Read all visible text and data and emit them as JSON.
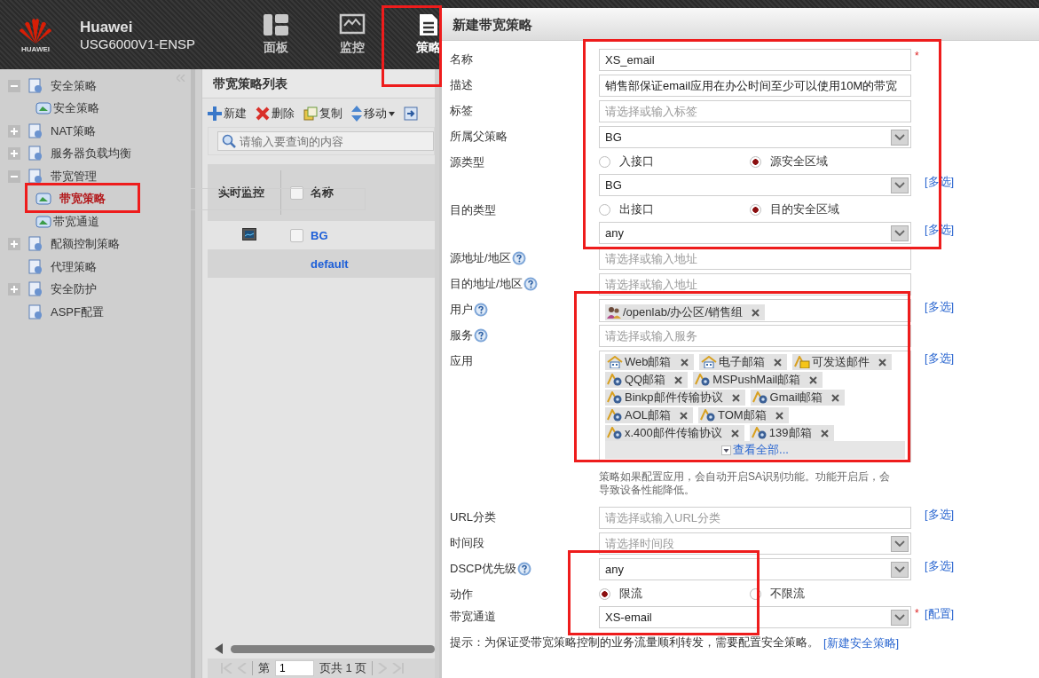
{
  "header": {
    "logo_text": "HUAWEI",
    "brand": "Huawei",
    "model": "USG6000V1-ENSP",
    "nav": [
      {
        "label": "面板",
        "selected": false,
        "highlighted": false
      },
      {
        "label": "监控",
        "selected": false,
        "highlighted": false
      },
      {
        "label": "策略",
        "selected": true,
        "highlighted": true
      }
    ]
  },
  "sidebar": {
    "items": [
      {
        "label": "安全策略",
        "expanded": true,
        "selected": false,
        "children": [
          {
            "label": "安全策略",
            "selected": false,
            "highlighted": false
          }
        ]
      },
      {
        "label": "NAT策略",
        "expanded": false,
        "selected": false
      },
      {
        "label": "服务器负载均衡",
        "expanded": false,
        "selected": false
      },
      {
        "label": "带宽管理",
        "expanded": true,
        "selected": false,
        "children": [
          {
            "label": "带宽策略",
            "selected": true,
            "highlighted": true
          },
          {
            "label": "带宽通道",
            "selected": false,
            "highlighted": false
          }
        ]
      },
      {
        "label": "配额控制策略",
        "expanded": false,
        "selected": false
      },
      {
        "label": "代理策略",
        "selected": false
      },
      {
        "label": "安全防护",
        "expanded": false,
        "selected": false
      },
      {
        "label": "ASPF配置",
        "selected": false
      }
    ]
  },
  "list_panel": {
    "title": "带宽策略列表",
    "toolbar": [
      {
        "label": "新建",
        "kind": "add"
      },
      {
        "label": "删除",
        "kind": "delete"
      },
      {
        "label": "复制",
        "kind": "copy"
      },
      {
        "label": "移动",
        "kind": "move"
      },
      {
        "kind": "import"
      }
    ],
    "search": {
      "placeholder": "请输入要查询的内容"
    },
    "columns": [
      "实时监控",
      "名称"
    ],
    "header_checked": false,
    "rows": [
      {
        "name": "BG",
        "monitor": true,
        "checkbox": true,
        "checked": false,
        "selected": false
      },
      {
        "name": "default",
        "monitor": false,
        "checkbox": false,
        "selected": true
      }
    ],
    "pager": {
      "prefix": "第",
      "page": "1",
      "suffix": "页共 1 页"
    }
  },
  "dialog": {
    "title": "新建带宽策略",
    "sections": [
      {
        "highlighted": true,
        "fields": [
          {
            "kind": "text",
            "label": "名称",
            "value": "XS_email",
            "required_mark": "*"
          },
          {
            "kind": "text",
            "label": "描述",
            "value": "销售部保证email应用在办公时间至少可以使用10M的带宽"
          },
          {
            "kind": "text",
            "label": "标签",
            "placeholder": "请选择或输入标签"
          },
          {
            "kind": "select",
            "label": "所属父策略",
            "value": "BG"
          },
          {
            "kind": "radio",
            "label": "源类型",
            "options": [
              {
                "label": "入接口",
                "selected": false
              },
              {
                "label": "源安全区域",
                "selected": true
              }
            ]
          },
          {
            "kind": "select",
            "value": "BG",
            "link": "[多选]"
          },
          {
            "kind": "radio",
            "label": "目的类型",
            "options": [
              {
                "label": "出接口",
                "selected": false
              },
              {
                "label": "目的安全区域",
                "selected": true
              }
            ]
          },
          {
            "kind": "select",
            "value": "any",
            "link": "[多选]"
          }
        ]
      },
      {
        "highlighted": false,
        "fields": [
          {
            "kind": "text",
            "label": "源地址/地区",
            "help": true,
            "placeholder": "请选择或输入地址"
          },
          {
            "kind": "text",
            "label": "目的地址/地区",
            "help": true,
            "placeholder": "请选择或输入地址"
          }
        ]
      },
      {
        "highlighted": true,
        "fields": [
          {
            "kind": "users",
            "label": "用户",
            "help": true,
            "tags": [
              "/openlab/办公区/销售组"
            ],
            "link": "[多选]"
          },
          {
            "kind": "text",
            "label": "服务",
            "help": true,
            "placeholder": "请选择或输入服务"
          },
          {
            "kind": "apps",
            "label": "应用",
            "tags": [
              "Web邮箱",
              "电子邮箱",
              "可发送邮件",
              "QQ邮箱",
              "MSPushMail邮箱",
              "Binkp邮件传输协议",
              "Gmail邮箱",
              "AOL邮箱",
              "TOM邮箱",
              "x.400邮件传输协议",
              "139邮箱"
            ],
            "more": "查看全部...",
            "link": "[多选]"
          }
        ]
      },
      {
        "highlighted": false,
        "fields": [
          {
            "kind": "note",
            "text": "策略如果配置应用，会自动开启SA识别功能。功能开启后，会导致设备性能降低。"
          },
          {
            "kind": "text",
            "label": "URL分类",
            "placeholder": "请选择或输入URL分类",
            "link": "[多选]"
          },
          {
            "kind": "select",
            "label": "时间段",
            "placeholder": "请选择时间段"
          }
        ]
      },
      {
        "highlighted": true,
        "fields": [
          {
            "kind": "select",
            "label": "DSCP优先级",
            "help": true,
            "value": "any",
            "link": "[多选]"
          },
          {
            "kind": "radio",
            "label": "动作",
            "options": [
              {
                "label": "限流",
                "selected": true
              },
              {
                "label": "不限流",
                "selected": false
              }
            ]
          },
          {
            "kind": "select",
            "label": "带宽通道",
            "value": "XS-email",
            "required_mark": "*",
            "link": "[配置]"
          }
        ]
      }
    ],
    "hint": {
      "text": "提示：为保证受带宽策略控制的业务流量顺利转发，需要配置安全策略。",
      "link": "[新建安全策略]"
    }
  }
}
